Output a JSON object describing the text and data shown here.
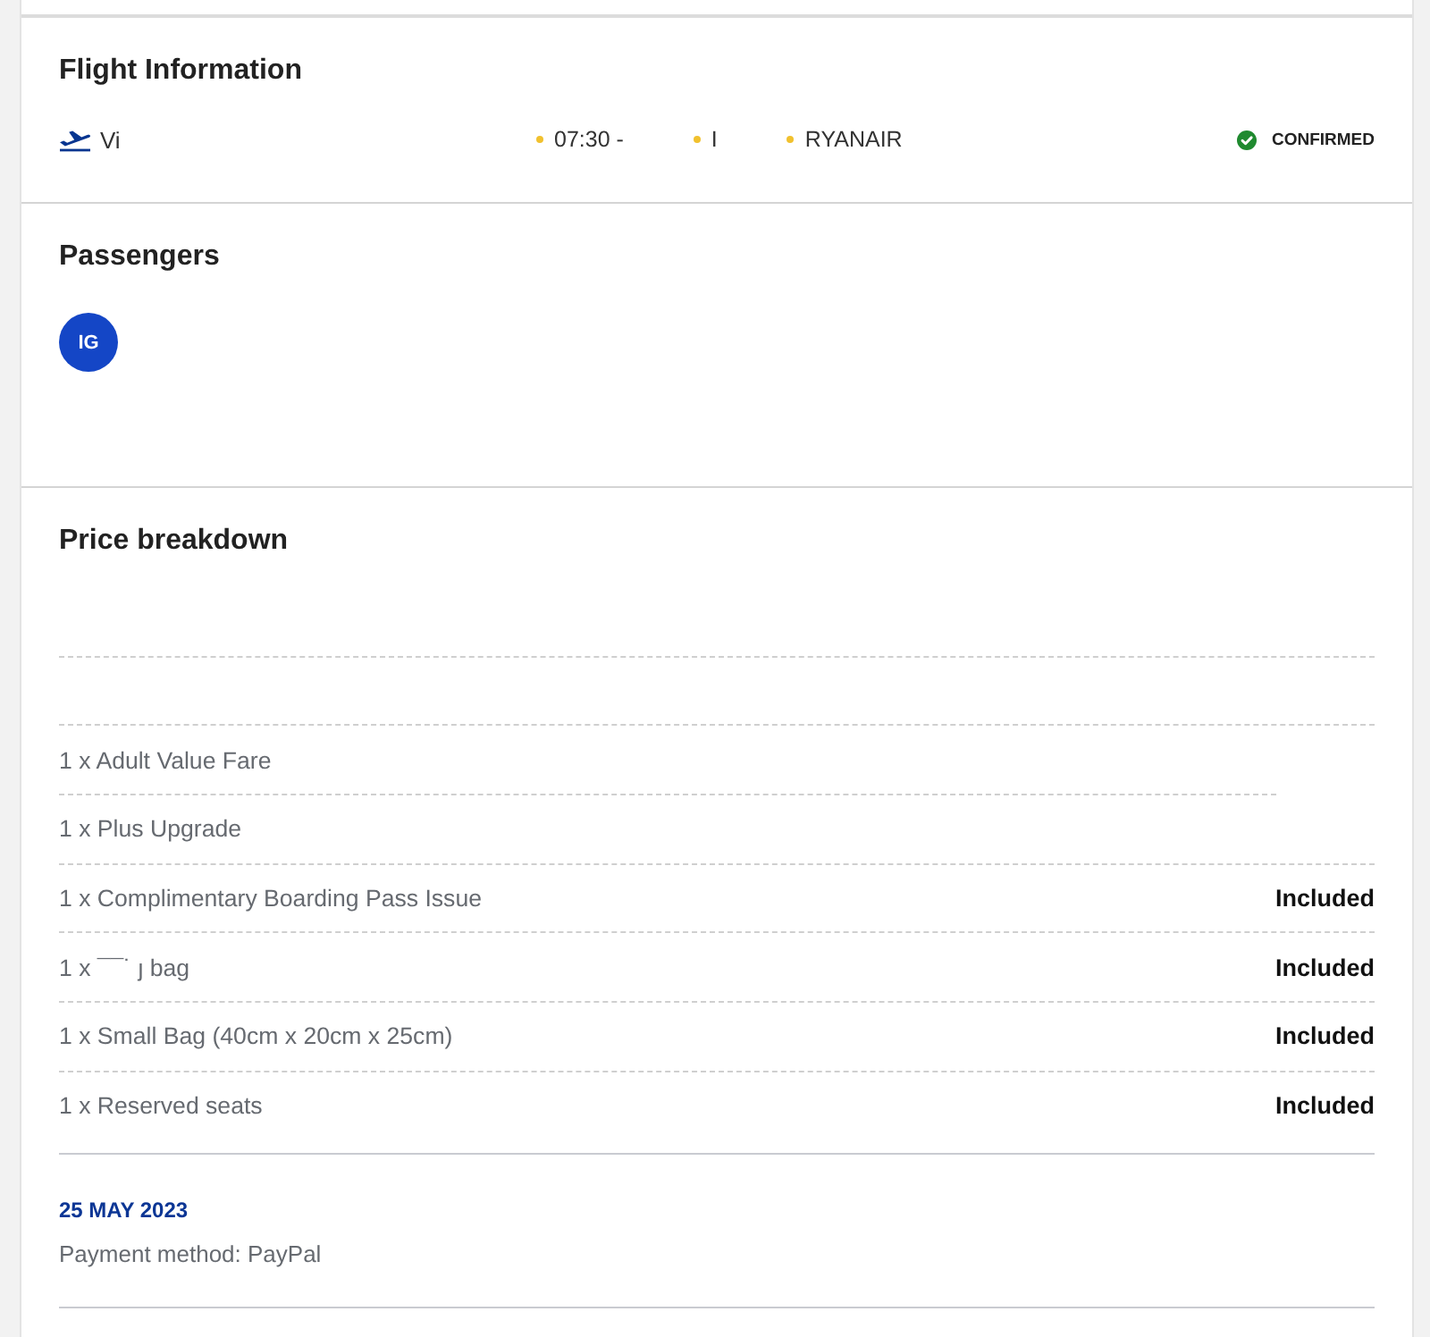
{
  "flight_information": {
    "title": "Flight Information",
    "route": "Vi",
    "details": [
      {
        "text": "07:30 -"
      },
      {
        "text": "I"
      },
      {
        "text": "RYANAIR"
      }
    ],
    "status": {
      "kind": "confirmed",
      "label": "CONFIRMED"
    }
  },
  "passengers": {
    "title": "Passengers",
    "avatars": [
      {
        "initials": "IG"
      }
    ]
  },
  "price_breakdown": {
    "title": "Price breakdown",
    "items": [
      {
        "label": "1 x Adult Value Fare"
      },
      {
        "label": "1 x Plus Upgrade"
      },
      {
        "label": "1 x Complimentary Boarding Pass Issue",
        "price": "Included"
      },
      {
        "label": "1 x ¯¯˙ ȷ bag",
        "price": "Included"
      },
      {
        "label": "1 x Small Bag (40cm x 20cm x 25cm)",
        "price": "Included"
      },
      {
        "label": "1 x Reserved seats",
        "price": "Included"
      }
    ]
  },
  "payment": {
    "date": "25 MAY 2023",
    "method": "Payment method: PayPal"
  }
}
